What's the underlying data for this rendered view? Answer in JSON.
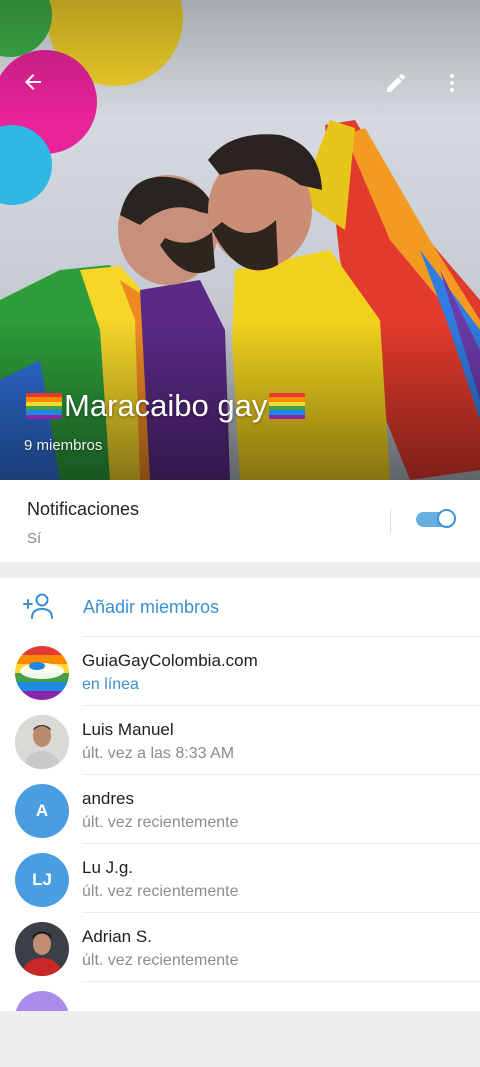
{
  "header": {
    "title": "Maracaibo gay",
    "members_count": "9 miembros",
    "icons": [
      "back-arrow-icon",
      "pencil-icon",
      "more-vert-icon"
    ]
  },
  "notifications": {
    "label": "Notificaciones",
    "value": "Sí",
    "enabled": true
  },
  "members": {
    "add_label": "Añadir miembros",
    "list": [
      {
        "name": "GuiaGayColombia.com",
        "status": "en línea",
        "online": true
      },
      {
        "name": "Luis Manuel",
        "status": "últ. vez a las 8:33 AM",
        "online": false
      },
      {
        "name": "andres",
        "status": "últ. vez recientemente",
        "initials": "A",
        "online": false
      },
      {
        "name": "Lu J.g.",
        "status": "últ. vez recientemente",
        "initials": "LJ",
        "online": false
      },
      {
        "name": "Adrian S.",
        "status": "últ. vez recientemente",
        "online": false
      }
    ]
  },
  "colors": {
    "accent": "#3a8fd1",
    "avatar_blue": "#4a9de0",
    "avatar_purple": "#a98bea",
    "toggle_track": "#68aee3"
  }
}
